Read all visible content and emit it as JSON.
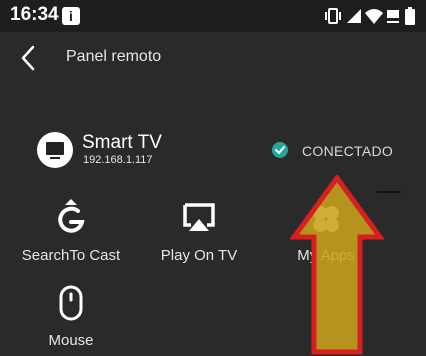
{
  "status_bar": {
    "time": "16:34",
    "app_icon": "i",
    "icons": [
      "vibrate-icon",
      "signal-icon",
      "wifi-icon",
      "no-sim-icon",
      "battery-icon"
    ]
  },
  "app_bar": {
    "title": "Panel remoto",
    "back_icon": "chevron-left-icon"
  },
  "device": {
    "name": "Smart TV",
    "ip": "192.168.1.117",
    "status": "CONECTADO",
    "status_color": "#26a69a"
  },
  "actions": [
    {
      "label": "SearchTo Cast",
      "icon": "google-cast-icon"
    },
    {
      "label": "Play On TV",
      "icon": "airplay-icon"
    },
    {
      "label": "My Apps",
      "icon": "apps-clover-icon"
    },
    {
      "label": "Mouse",
      "icon": "mouse-icon"
    }
  ],
  "overlay": {
    "arrow_fill": "#c8a21a",
    "arrow_stroke": "#d62020"
  },
  "colors": {
    "background": "#2a2a2a",
    "status_bar": "#1e1e1e",
    "text": "#e6e6e6"
  }
}
